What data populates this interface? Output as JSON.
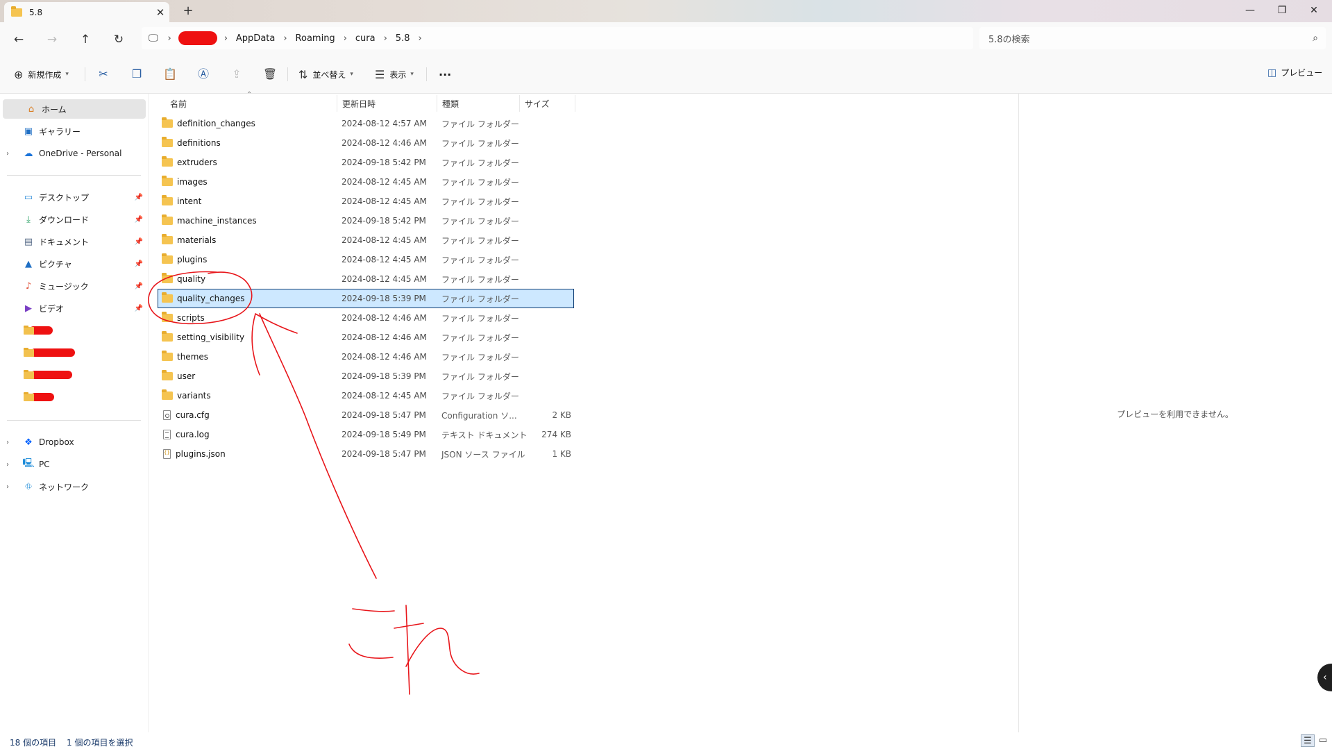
{
  "window": {
    "tab_title": "5.8",
    "tab_close": "✕",
    "new_tab": "+",
    "controls": {
      "minimize": "—",
      "maximize": "❐",
      "close": "✕"
    }
  },
  "nav_buttons": {
    "back": "←",
    "forward": "→",
    "up": "↑",
    "refresh": "↻"
  },
  "breadcrumb": [
    "AppData",
    "Roaming",
    "cura",
    "5.8"
  ],
  "search": {
    "placeholder": "5.8の検索"
  },
  "commands": {
    "new_label": "新規作成",
    "sort_label": "並べ替え",
    "view_label": "表示",
    "more": "···",
    "preview_label": "プレビュー"
  },
  "sidebar": {
    "quick": [
      {
        "label": "ホーム",
        "icon": "home-icon",
        "selected": true
      },
      {
        "label": "ギャラリー",
        "icon": "gallery-icon"
      },
      {
        "label": "OneDrive - Personal",
        "icon": "cloud-icon",
        "expandable": true
      }
    ],
    "pinned": [
      {
        "label": "デスクトップ",
        "icon": "desktop-icon"
      },
      {
        "label": "ダウンロード",
        "icon": "download-icon"
      },
      {
        "label": "ドキュメント",
        "icon": "documents-icon"
      },
      {
        "label": "ピクチャ",
        "icon": "pictures-icon"
      },
      {
        "label": "ミュージック",
        "icon": "music-icon"
      },
      {
        "label": "ビデオ",
        "icon": "video-icon"
      }
    ],
    "locations": [
      {
        "label": "Dropbox",
        "icon": "dropbox-icon"
      },
      {
        "label": "PC",
        "icon": "pc-icon"
      },
      {
        "label": "ネットワーク",
        "icon": "network-icon"
      }
    ]
  },
  "columns": {
    "name": "名前",
    "date": "更新日時",
    "type": "種類",
    "size": "サイズ"
  },
  "files": [
    {
      "name": "definition_changes",
      "date": "2024-08-12 4:57 AM",
      "type": "ファイル フォルダー",
      "size": "",
      "kind": "folder"
    },
    {
      "name": "definitions",
      "date": "2024-08-12 4:46 AM",
      "type": "ファイル フォルダー",
      "size": "",
      "kind": "folder"
    },
    {
      "name": "extruders",
      "date": "2024-09-18 5:42 PM",
      "type": "ファイル フォルダー",
      "size": "",
      "kind": "folder"
    },
    {
      "name": "images",
      "date": "2024-08-12 4:45 AM",
      "type": "ファイル フォルダー",
      "size": "",
      "kind": "folder"
    },
    {
      "name": "intent",
      "date": "2024-08-12 4:45 AM",
      "type": "ファイル フォルダー",
      "size": "",
      "kind": "folder"
    },
    {
      "name": "machine_instances",
      "date": "2024-09-18 5:42 PM",
      "type": "ファイル フォルダー",
      "size": "",
      "kind": "folder"
    },
    {
      "name": "materials",
      "date": "2024-08-12 4:45 AM",
      "type": "ファイル フォルダー",
      "size": "",
      "kind": "folder"
    },
    {
      "name": "plugins",
      "date": "2024-08-12 4:45 AM",
      "type": "ファイル フォルダー",
      "size": "",
      "kind": "folder"
    },
    {
      "name": "quality",
      "date": "2024-08-12 4:45 AM",
      "type": "ファイル フォルダー",
      "size": "",
      "kind": "folder"
    },
    {
      "name": "quality_changes",
      "date": "2024-09-18 5:39 PM",
      "type": "ファイル フォルダー",
      "size": "",
      "kind": "folder",
      "selected": true
    },
    {
      "name": "scripts",
      "date": "2024-08-12 4:46 AM",
      "type": "ファイル フォルダー",
      "size": "",
      "kind": "folder"
    },
    {
      "name": "setting_visibility",
      "date": "2024-08-12 4:46 AM",
      "type": "ファイル フォルダー",
      "size": "",
      "kind": "folder"
    },
    {
      "name": "themes",
      "date": "2024-08-12 4:46 AM",
      "type": "ファイル フォルダー",
      "size": "",
      "kind": "folder"
    },
    {
      "name": "user",
      "date": "2024-09-18 5:39 PM",
      "type": "ファイル フォルダー",
      "size": "",
      "kind": "folder"
    },
    {
      "name": "variants",
      "date": "2024-08-12 4:45 AM",
      "type": "ファイル フォルダー",
      "size": "",
      "kind": "folder"
    },
    {
      "name": "cura.cfg",
      "date": "2024-09-18 5:47 PM",
      "type": "Configuration ソ...",
      "size": "2 KB",
      "kind": "cfg"
    },
    {
      "name": "cura.log",
      "date": "2024-09-18 5:49 PM",
      "type": "テキスト ドキュメント",
      "size": "274 KB",
      "kind": "log"
    },
    {
      "name": "plugins.json",
      "date": "2024-09-18 5:47 PM",
      "type": "JSON ソース ファイル",
      "size": "1 KB",
      "kind": "json"
    }
  ],
  "preview": {
    "message": "プレビューを利用できません。"
  },
  "status": {
    "item_count": "18 個の項目",
    "selection": "1 個の項目を選択"
  },
  "annotation": {
    "handwritten_text": "これ",
    "color": "#e8161b"
  },
  "colors": {
    "selection_bg": "#cde8ff",
    "selection_border": "#0c3b72",
    "folder": "#f5c451",
    "accent": "#2b5fa3"
  }
}
